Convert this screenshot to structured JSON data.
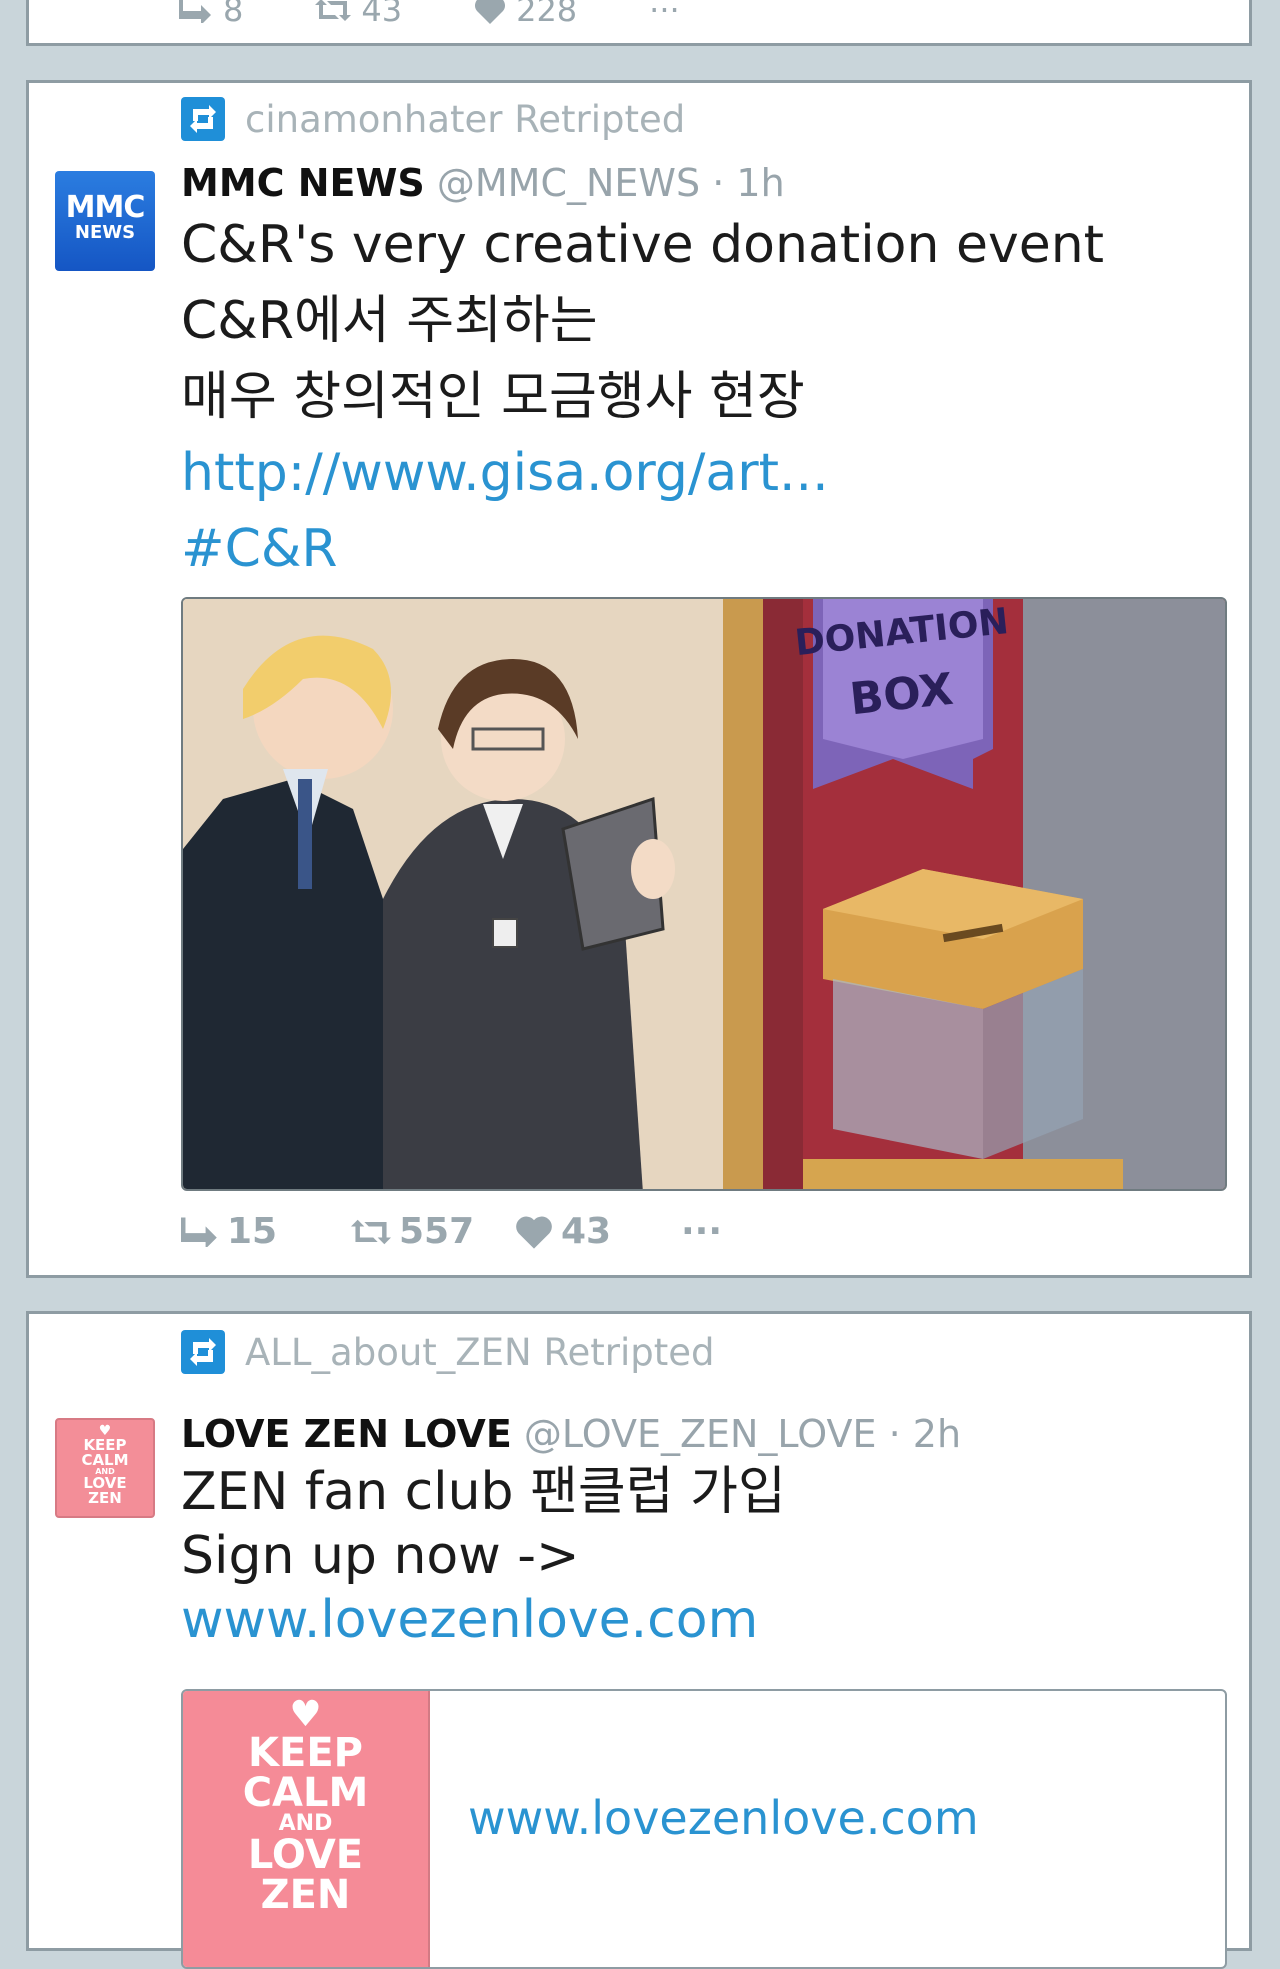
{
  "previous_tweet": {
    "reply_count": "8",
    "retweet_count": "43",
    "like_count": "228",
    "more_label": "···"
  },
  "tweet1": {
    "retweeted_by": "cinamonhater Retripted",
    "avatar": {
      "line1": "MMC",
      "line2": "NEWS"
    },
    "author_name": "MMC NEWS",
    "author_handle": "@MMC_NEWS",
    "separator": "·",
    "time": "1h",
    "lines": [
      "C&R's very creative donation event",
      "C&R에서 주최하는",
      "매우 창의적인 모금행사 현장"
    ],
    "link": "http://www.gisa.org/art...",
    "hashtag": "#C&R",
    "media": {
      "sign_line1": "DONATION",
      "sign_line2": "BOX"
    },
    "reply_count": "15",
    "retweet_count": "557",
    "like_count": "43",
    "more_label": "···"
  },
  "tweet2": {
    "retweeted_by": "ALL_about_ZEN Retripted",
    "avatar_text": {
      "l1": "KEEP",
      "l2": "CALM",
      "l3": "AND",
      "l4": "LOVE",
      "l5": "ZEN"
    },
    "author_name": "LOVE ZEN LOVE",
    "author_handle": "@LOVE_ZEN_LOVE",
    "separator": "·",
    "time": "2h",
    "lines": [
      "ZEN fan club 팬클럽 가입",
      "Sign up now ->"
    ],
    "link": "www.lovezenlove.com",
    "card": {
      "thumb_text": {
        "l1": "KEEP",
        "l2": "CALM",
        "l3": "AND",
        "l4": "LOVE",
        "l5": "ZEN"
      },
      "url": "www.lovezenlove.com"
    }
  },
  "colors": {
    "background": "#c9d5da",
    "card_border": "#8e9ca3",
    "link": "#2a93d1",
    "retweet_icon": "#1f8fd8",
    "zen_pink": "#f58b97"
  },
  "icons": {
    "reply": "reply-arrow-icon",
    "retweet": "retweet-icon",
    "like": "heart-icon",
    "more": "ellipsis-icon",
    "retweeted": "retweet-square-icon"
  }
}
